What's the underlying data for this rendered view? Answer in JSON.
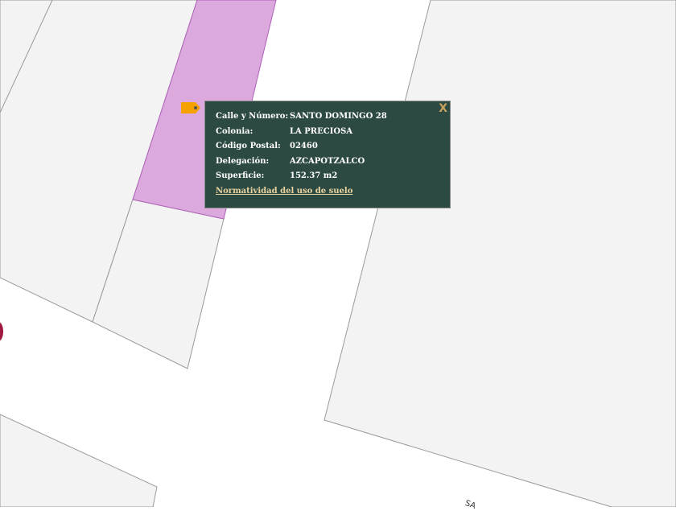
{
  "popup": {
    "close_label": "X",
    "rows": [
      {
        "label": "Calle y Número:",
        "value": "SANTO DOMINGO 28"
      },
      {
        "label": "Colonia:",
        "value": "LA PRECIOSA"
      },
      {
        "label": "Código Postal:",
        "value": "02460"
      },
      {
        "label": "Delegación:",
        "value": "AZCAPOTZALCO"
      },
      {
        "label": "Superficie:",
        "value": "152.37 m2"
      }
    ],
    "link": "Normatividad del uso de suelo"
  },
  "map": {
    "street_label": "SA",
    "colors": {
      "parcel": "#f3f3f3",
      "parcel_stroke": "#9a9a9a",
      "selected": "#dba9de",
      "selected_stroke": "#b060b8",
      "road": "#ffffff",
      "marker": "#a01840"
    }
  }
}
